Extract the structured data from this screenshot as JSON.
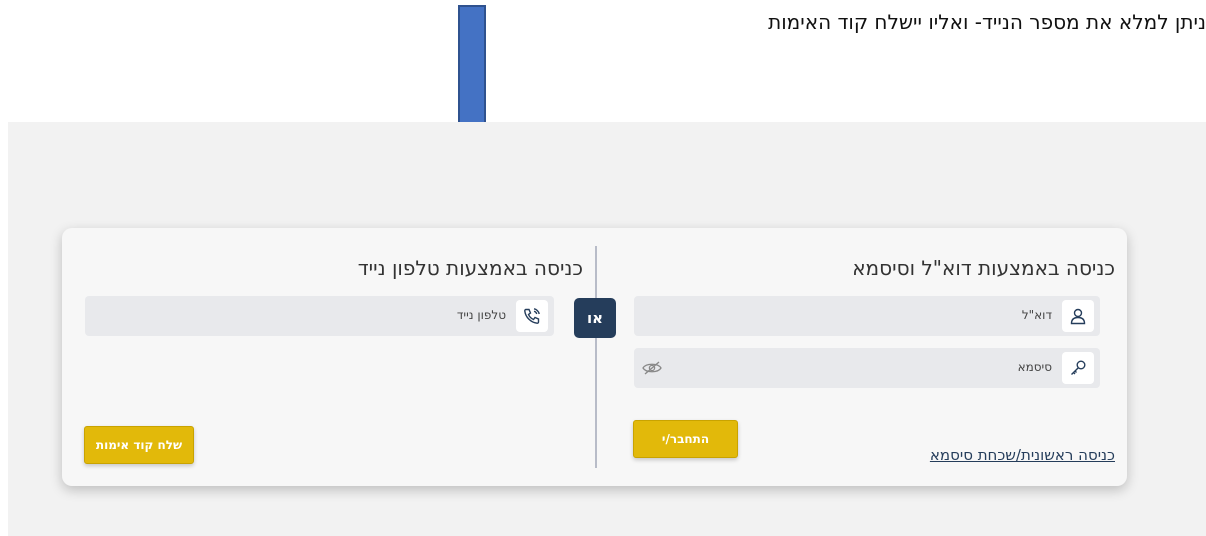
{
  "annotation": {
    "text": "ניתן למלא את מספר הנייד- ואליו יישלח קוד האימות"
  },
  "email_section": {
    "title": "כניסה באמצעות דוא\"ל וסיסמא",
    "email_placeholder": "דוא\"ל",
    "email_icon": "user-icon",
    "password_placeholder": "סיסמא",
    "password_icon": "key-icon",
    "toggle_icon": "eye-off-icon",
    "login_button": "התחבר/י",
    "forgot_link": "כניסה ראשונית/שכחת סיסמא"
  },
  "divider": {
    "or_label": "או"
  },
  "phone_section": {
    "title": "כניסה באמצעות טלפון נייד",
    "phone_placeholder": "טלפון נייד",
    "phone_icon": "phone-icon",
    "send_code_button": "שלח קוד אימות"
  },
  "colors": {
    "accent": "#e2b90a",
    "badge": "#253d5b",
    "arrow": "#4472c4",
    "field_bg": "#e8e9ec"
  }
}
